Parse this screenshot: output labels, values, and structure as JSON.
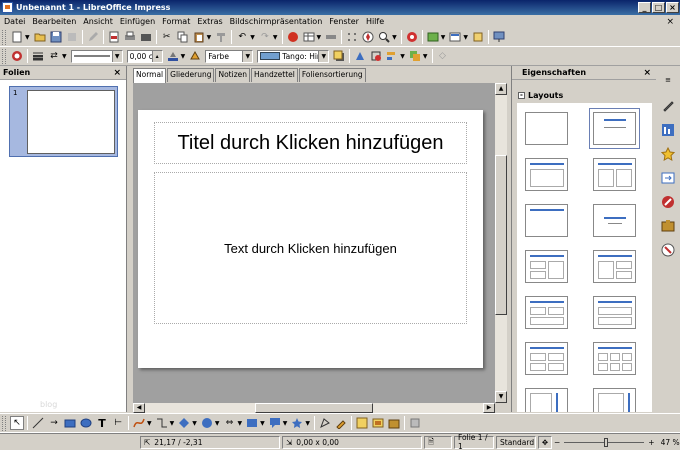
{
  "window": {
    "title": "Unbenannt 1 - LibreOffice Impress",
    "minimize": "_",
    "maximize": "□",
    "close": "×"
  },
  "menu": [
    "Datei",
    "Bearbeiten",
    "Ansicht",
    "Einfügen",
    "Format",
    "Extras",
    "Bildschirmpräsentation",
    "Fenster",
    "Hilfe"
  ],
  "menu_close": "×",
  "toolbar2": {
    "line_width": "0,00 cm",
    "fill_type": "Farbe",
    "fill_color": "Tango: Hin"
  },
  "slides_pane": {
    "title": "Folien",
    "close": "×",
    "slide_number": "1",
    "watermark": "blog"
  },
  "view_tabs": [
    "Normal",
    "Gliederung",
    "Notizen",
    "Handzettel",
    "Foliensortierung"
  ],
  "slide": {
    "title_placeholder": "Titel durch Klicken hinzufügen",
    "body_placeholder": "Text durch Klicken hinzufügen"
  },
  "properties": {
    "title": "Eigenschaften",
    "close": "×",
    "section": "Layouts",
    "collapse": "-"
  },
  "colors": {
    "accent": "#3d6ec0",
    "titlebar": "#0a246a",
    "selection": "#a6b8e0"
  },
  "statusbar": {
    "position": "21,17 / -2,31",
    "size": "0,00 x 0,00",
    "slide": "Folie 1 / 1",
    "layout": "Standard",
    "zoom": "47 %"
  }
}
